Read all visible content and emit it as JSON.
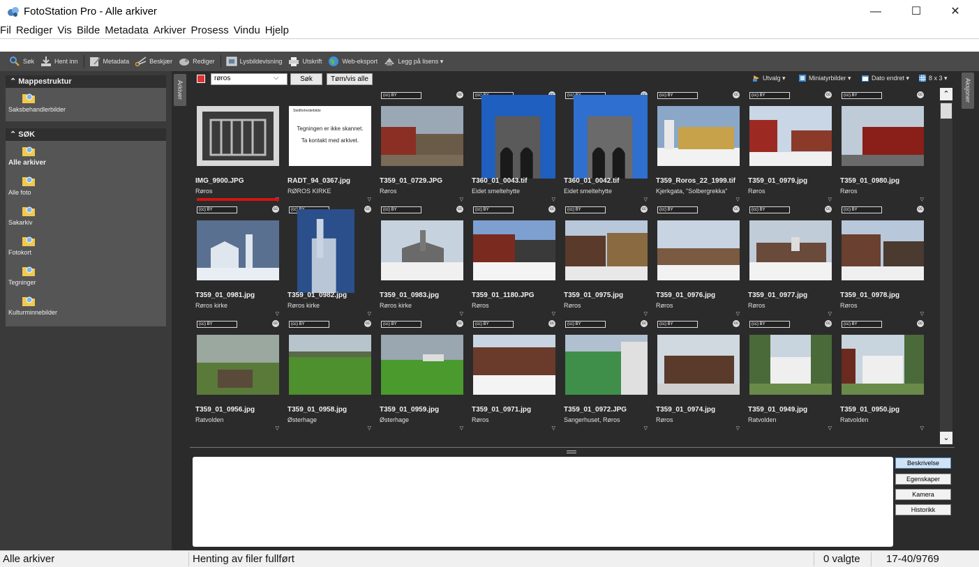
{
  "window": {
    "title": "FotoStation Pro - Alle arkiver",
    "minimize": "—",
    "maximize": "☐",
    "close": "✕"
  },
  "menu": [
    "Fil",
    "Rediger",
    "Vis",
    "Bilde",
    "Metadata",
    "Arkiver",
    "Prosess",
    "Vindu",
    "Hjelp"
  ],
  "toolbar": {
    "search": "Søk",
    "import": "Hent inn",
    "metadata": "Metadata",
    "crop": "Beskjær",
    "edit": "Rediger",
    "slideshow": "Lysbildevisning",
    "print": "Utskrift",
    "webexport": "Web-eksport",
    "license": "Legg på lisens ▾"
  },
  "sidebar": {
    "folders_header": "⌃ Mappestruktur",
    "folders": [
      {
        "label": "Saksbehandlerbilder"
      }
    ],
    "search_header": "⌃ SØK",
    "searches": [
      {
        "label": "Alle arkiver",
        "bold": true
      },
      {
        "label": "Alle foto"
      },
      {
        "label": "Sakarkiv"
      },
      {
        "label": "Fotokort"
      },
      {
        "label": "Tegninger"
      },
      {
        "label": "Kulturminnebilder"
      }
    ],
    "left_tab": "Arkiver",
    "right_tab": "Aksjoner"
  },
  "search": {
    "query": "røros",
    "search_button": "Søk",
    "clear_button": "Tøm/vis alle",
    "selection": "Utvalg ▾",
    "view_mode": "Miniatyrbilder ▾",
    "sort": "Dato endret ▾",
    "grid_size": "8 x 3 ▾"
  },
  "license_badge": "(cc) BY",
  "thumbnails": [
    {
      "file": "IMG_9900.JPG",
      "desc": "Røros",
      "cc": false,
      "selected": true
    },
    {
      "file": "RADT_94_0367.jpg",
      "desc": "RØROS KIRKE",
      "cc": false,
      "note1": "Stedfortrederbilde",
      "note2": "Tegningen er ikke skannet.",
      "note3": "Ta kontakt med arkivet."
    },
    {
      "file": "T359_01_0729.JPG",
      "desc": "Røros",
      "cc": true
    },
    {
      "file": "T360_01_0043.tif",
      "desc": "Eidet smeltehytte",
      "cc": true
    },
    {
      "file": "T360_01_0042.tif",
      "desc": "Eidet smeltehytte",
      "cc": true
    },
    {
      "file": "T359_Roros_22_1999.tif",
      "desc": "Kjerkgata, \"Solbergrekka\"",
      "cc": true
    },
    {
      "file": "T359_01_0979.jpg",
      "desc": "Røros",
      "cc": true
    },
    {
      "file": "T359_01_0980.jpg",
      "desc": "Røros",
      "cc": true
    },
    {
      "file": "T359_01_0981.jpg",
      "desc": "Røros kirke",
      "cc": true
    },
    {
      "file": "T359_01_0982.jpg",
      "desc": "Røros kirke",
      "cc": true
    },
    {
      "file": "T359_01_0983.jpg",
      "desc": "Røros kirke",
      "cc": true
    },
    {
      "file": "T359_01_1180.JPG",
      "desc": "Røros",
      "cc": true
    },
    {
      "file": "T359_01_0975.jpg",
      "desc": "Røros",
      "cc": true
    },
    {
      "file": "T359_01_0976.jpg",
      "desc": "Røros",
      "cc": true
    },
    {
      "file": "T359_01_0977.jpg",
      "desc": "Røros",
      "cc": true
    },
    {
      "file": "T359_01_0978.jpg",
      "desc": "Røros",
      "cc": true
    },
    {
      "file": "T359_01_0956.jpg",
      "desc": "Ratvolden",
      "cc": true
    },
    {
      "file": "T359_01_0958.jpg",
      "desc": "Østerhage",
      "cc": true
    },
    {
      "file": "T359_01_0959.jpg",
      "desc": "Østerhage",
      "cc": true
    },
    {
      "file": "T359_01_0971.jpg",
      "desc": "Røros",
      "cc": true
    },
    {
      "file": "T359_01_0972.JPG",
      "desc": "Sangerhuset, Røros",
      "cc": true
    },
    {
      "file": "T359_01_0974.jpg",
      "desc": "Røros",
      "cc": true
    },
    {
      "file": "T359_01_0949.jpg",
      "desc": "Ratvolden",
      "cc": true
    },
    {
      "file": "T359_01_0950.jpg",
      "desc": "Ratvolden",
      "cc": true
    }
  ],
  "info_tabs": {
    "description": "Beskrivelse",
    "properties": "Egenskaper",
    "camera": "Kamera",
    "history": "Historikk"
  },
  "status": {
    "archive": "Alle arkiver",
    "message": "Henting av filer fullført",
    "selected": "0 valgte",
    "count": "17-40/9769"
  },
  "colors": {
    "accent_red": "#d31414",
    "panel_dark": "#2b2b2b",
    "sidebar": "#3a3a3a"
  }
}
